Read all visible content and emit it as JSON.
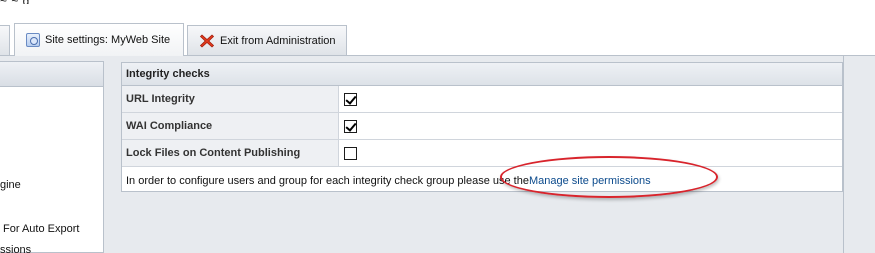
{
  "tabs": [
    {
      "label": "Site settings: MyWeb Site",
      "icon": "site-settings-icon",
      "active": true
    },
    {
      "label": "Exit from Administration",
      "icon": "exit-icon",
      "active": false
    }
  ],
  "left_panel": {
    "items": [
      "gine",
      "For Auto Export",
      "ssions"
    ]
  },
  "integrity": {
    "title": "Integrity checks",
    "rows": [
      {
        "label": "URL Integrity",
        "checked": true
      },
      {
        "label": "WAI Compliance",
        "checked": true
      },
      {
        "label": "Lock Files on Content Publishing",
        "checked": false
      }
    ],
    "info_text": "In order to configure users and group for each integrity check group please use the ",
    "link_text": "Manage site permissions"
  },
  "colors": {
    "link": "#0b4a8c",
    "annotation": "#d8242c",
    "panel_bg": "#e7eaee"
  }
}
